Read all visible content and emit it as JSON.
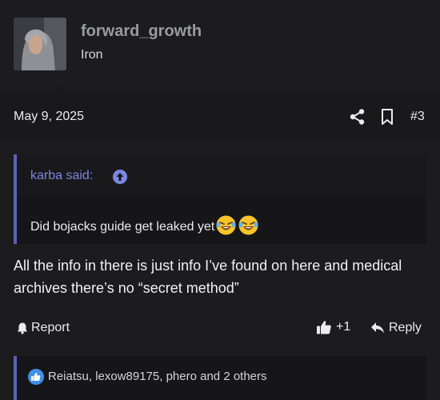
{
  "user": {
    "name": "forward_growth",
    "title": "Iron"
  },
  "post": {
    "date": "May 9, 2025",
    "number": "#3",
    "message": "All the info in there is just info I’ve found on here and medical archives there’s no “secret method”"
  },
  "quote": {
    "author": "karba said:",
    "text": "Did bojacks guide get leaked yet",
    "emoji": [
      "rolling-laughing-emoji",
      "rolling-laughing-emoji"
    ]
  },
  "actions": {
    "report": "Report",
    "likes": "+1",
    "reply": "Reply"
  },
  "reactions": {
    "text": "Reiatsu, lexow89175, phero and 2 others"
  },
  "colors": {
    "accent": "#5b63b6",
    "link": "#7b86e2",
    "background": "#1c1c1e"
  }
}
